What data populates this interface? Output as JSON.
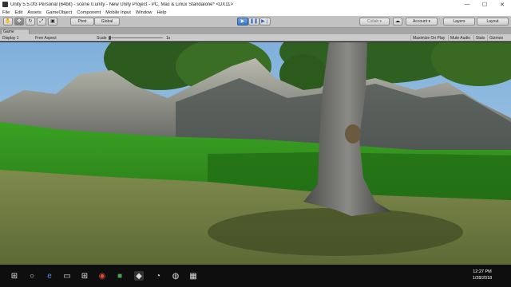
{
  "window": {
    "title": "Unity 5.5.0f3 Personal (64bit) - scene 0.unity - New Unity Project - PC, Mac & Linux Standalone* <DX11>",
    "minimize": "—",
    "maximize": "☐",
    "close": "✕"
  },
  "menu": [
    "File",
    "Edit",
    "Assets",
    "GameObject",
    "Component",
    "Mobile Input",
    "Window",
    "Help"
  ],
  "toolbar": {
    "pivot_label": "Pivot",
    "global_label": "Global",
    "collab_label": "Collab ▾",
    "account_label": "Account ▾",
    "layers_label": "Layers",
    "layout_label": "Layout",
    "icons": [
      "hand-icon",
      "move-icon",
      "rotate-icon",
      "scale-icon",
      "rect-icon",
      "play-icon",
      "pause-icon",
      "step-icon",
      "cloud-icon"
    ]
  },
  "game_view": {
    "tab_label": "Game",
    "display_label": "Display 1",
    "aspect_label": "Free Aspect",
    "scale_label": "Scale",
    "scale_value": "1x",
    "scale_level": 0.0,
    "maximize_label": "Maximize On Play",
    "mute_label": "Mute Audio",
    "stats_label": "Stats",
    "gizmos_label": "Gizmos"
  },
  "taskbar": {
    "time": "12:27 PM",
    "date": "1/28/2018",
    "icons": [
      "windows-start-icon",
      "search-icon",
      "task-view-icon",
      "edge-browser-icon",
      "file-explorer-icon",
      "store-icon",
      "chrome-icon",
      "app-icon",
      "unity-icon",
      "app-icon-2",
      "app-icon-3"
    ]
  },
  "colors": {
    "sky": "#8ab4d8",
    "grass": "#3fa32a",
    "play_active": "#3a78c8",
    "editor_grey": "#c2c2c2",
    "taskbar": "#0e0e0e"
  }
}
